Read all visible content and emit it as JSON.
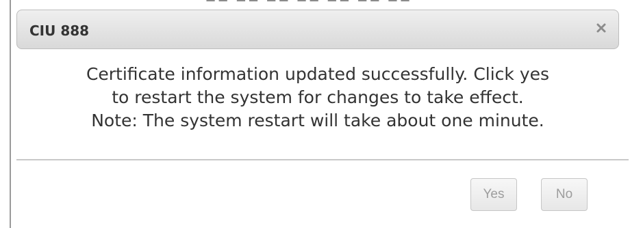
{
  "dialog": {
    "title": "CIU 888",
    "close_icon": "close-icon",
    "message_lines": [
      "Certificate information updated successfully. Click yes",
      "to restart the system for changes to take effect.",
      "Note: The system restart will take about one minute."
    ],
    "buttons": {
      "yes": "Yes",
      "no": "No"
    }
  },
  "colors": {
    "title_bar": "#dfdfdf",
    "text": "#333333",
    "disabled_button_text": "#9d9d9d",
    "border": "#c8c8c8"
  }
}
